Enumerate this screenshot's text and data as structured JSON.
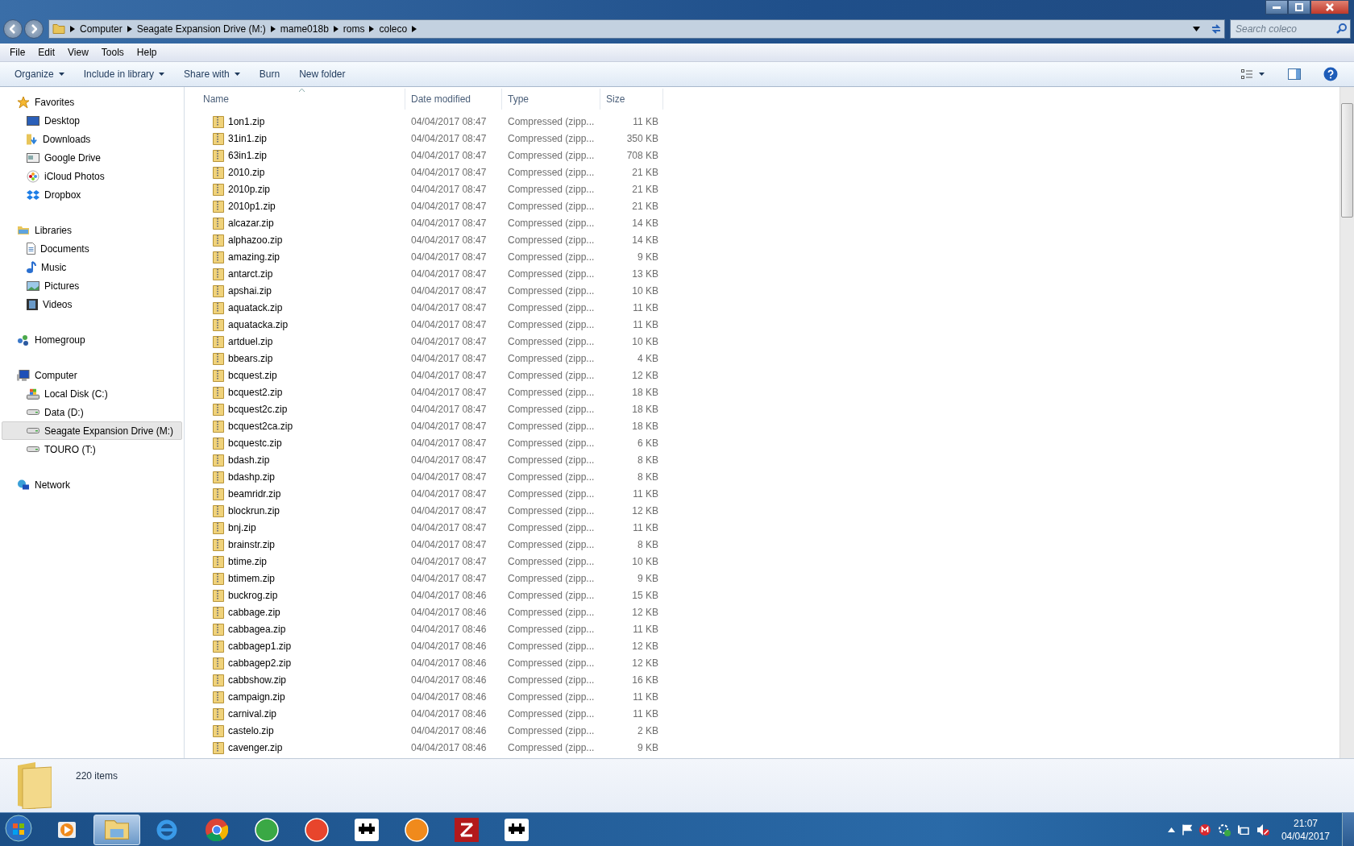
{
  "address": {
    "crumbs": [
      "Computer",
      "Seagate Expansion Drive (M:)",
      "mame018b",
      "roms",
      "coleco"
    ]
  },
  "search": {
    "placeholder": "Search coleco"
  },
  "menu": [
    "File",
    "Edit",
    "View",
    "Tools",
    "Help"
  ],
  "toolbar": [
    {
      "label": "Organize",
      "dropdown": true
    },
    {
      "label": "Include in library",
      "dropdown": true
    },
    {
      "label": "Share with",
      "dropdown": true
    },
    {
      "label": "Burn",
      "dropdown": false
    },
    {
      "label": "New folder",
      "dropdown": false
    }
  ],
  "nav": [
    {
      "label": "Favorites",
      "selected": false,
      "children": [
        {
          "label": "Desktop",
          "selected": false
        },
        {
          "label": "Downloads",
          "selected": false
        },
        {
          "label": "Google Drive",
          "selected": false
        },
        {
          "label": "iCloud Photos",
          "selected": false
        },
        {
          "label": "Dropbox",
          "selected": false
        }
      ]
    },
    {
      "label": "Libraries",
      "selected": false,
      "children": [
        {
          "label": "Documents",
          "selected": false
        },
        {
          "label": "Music",
          "selected": false
        },
        {
          "label": "Pictures",
          "selected": false
        },
        {
          "label": "Videos",
          "selected": false
        }
      ]
    },
    {
      "label": "Homegroup",
      "selected": false
    },
    {
      "label": "Computer",
      "selected": false,
      "children": [
        {
          "label": "Local Disk (C:)",
          "selected": false
        },
        {
          "label": "Data (D:)",
          "selected": false
        },
        {
          "label": "Seagate Expansion Drive (M:)",
          "selected": true
        },
        {
          "label": "TOURO (T:)",
          "selected": false
        }
      ]
    },
    {
      "label": "Network",
      "selected": false
    }
  ],
  "table": {
    "columns": [
      {
        "label": "Name",
        "sorted": true
      },
      {
        "label": "Date modified",
        "sorted": false
      },
      {
        "label": "Type",
        "sorted": false
      },
      {
        "label": "Size",
        "sorted": false
      }
    ],
    "rows": [
      [
        "1on1.zip",
        "04/04/2017 08:47",
        "Compressed (zipp...",
        "11 KB"
      ],
      [
        "31in1.zip",
        "04/04/2017 08:47",
        "Compressed (zipp...",
        "350 KB"
      ],
      [
        "63in1.zip",
        "04/04/2017 08:47",
        "Compressed (zipp...",
        "708 KB"
      ],
      [
        "2010.zip",
        "04/04/2017 08:47",
        "Compressed (zipp...",
        "21 KB"
      ],
      [
        "2010p.zip",
        "04/04/2017 08:47",
        "Compressed (zipp...",
        "21 KB"
      ],
      [
        "2010p1.zip",
        "04/04/2017 08:47",
        "Compressed (zipp...",
        "21 KB"
      ],
      [
        "alcazar.zip",
        "04/04/2017 08:47",
        "Compressed (zipp...",
        "14 KB"
      ],
      [
        "alphazoo.zip",
        "04/04/2017 08:47",
        "Compressed (zipp...",
        "14 KB"
      ],
      [
        "amazing.zip",
        "04/04/2017 08:47",
        "Compressed (zipp...",
        "9 KB"
      ],
      [
        "antarct.zip",
        "04/04/2017 08:47",
        "Compressed (zipp...",
        "13 KB"
      ],
      [
        "apshai.zip",
        "04/04/2017 08:47",
        "Compressed (zipp...",
        "10 KB"
      ],
      [
        "aquatack.zip",
        "04/04/2017 08:47",
        "Compressed (zipp...",
        "11 KB"
      ],
      [
        "aquatacka.zip",
        "04/04/2017 08:47",
        "Compressed (zipp...",
        "11 KB"
      ],
      [
        "artduel.zip",
        "04/04/2017 08:47",
        "Compressed (zipp...",
        "10 KB"
      ],
      [
        "bbears.zip",
        "04/04/2017 08:47",
        "Compressed (zipp...",
        "4 KB"
      ],
      [
        "bcquest.zip",
        "04/04/2017 08:47",
        "Compressed (zipp...",
        "12 KB"
      ],
      [
        "bcquest2.zip",
        "04/04/2017 08:47",
        "Compressed (zipp...",
        "18 KB"
      ],
      [
        "bcquest2c.zip",
        "04/04/2017 08:47",
        "Compressed (zipp...",
        "18 KB"
      ],
      [
        "bcquest2ca.zip",
        "04/04/2017 08:47",
        "Compressed (zipp...",
        "18 KB"
      ],
      [
        "bcquestc.zip",
        "04/04/2017 08:47",
        "Compressed (zipp...",
        "6 KB"
      ],
      [
        "bdash.zip",
        "04/04/2017 08:47",
        "Compressed (zipp...",
        "8 KB"
      ],
      [
        "bdashp.zip",
        "04/04/2017 08:47",
        "Compressed (zipp...",
        "8 KB"
      ],
      [
        "beamridr.zip",
        "04/04/2017 08:47",
        "Compressed (zipp...",
        "11 KB"
      ],
      [
        "blockrun.zip",
        "04/04/2017 08:47",
        "Compressed (zipp...",
        "12 KB"
      ],
      [
        "bnj.zip",
        "04/04/2017 08:47",
        "Compressed (zipp...",
        "11 KB"
      ],
      [
        "brainstr.zip",
        "04/04/2017 08:47",
        "Compressed (zipp...",
        "8 KB"
      ],
      [
        "btime.zip",
        "04/04/2017 08:47",
        "Compressed (zipp...",
        "10 KB"
      ],
      [
        "btimem.zip",
        "04/04/2017 08:47",
        "Compressed (zipp...",
        "9 KB"
      ],
      [
        "buckrog.zip",
        "04/04/2017 08:46",
        "Compressed (zipp...",
        "15 KB"
      ],
      [
        "cabbage.zip",
        "04/04/2017 08:46",
        "Compressed (zipp...",
        "12 KB"
      ],
      [
        "cabbagea.zip",
        "04/04/2017 08:46",
        "Compressed (zipp...",
        "11 KB"
      ],
      [
        "cabbagep1.zip",
        "04/04/2017 08:46",
        "Compressed (zipp...",
        "12 KB"
      ],
      [
        "cabbagep2.zip",
        "04/04/2017 08:46",
        "Compressed (zipp...",
        "12 KB"
      ],
      [
        "cabbshow.zip",
        "04/04/2017 08:46",
        "Compressed (zipp...",
        "16 KB"
      ],
      [
        "campaign.zip",
        "04/04/2017 08:46",
        "Compressed (zipp...",
        "11 KB"
      ],
      [
        "carnival.zip",
        "04/04/2017 08:46",
        "Compressed (zipp...",
        "11 KB"
      ],
      [
        "castelo.zip",
        "04/04/2017 08:46",
        "Compressed (zipp...",
        "2 KB"
      ],
      [
        "cavenger.zip",
        "04/04/2017 08:46",
        "Compressed (zipp...",
        "9 KB"
      ]
    ]
  },
  "status": {
    "count": "220 items"
  },
  "taskbar": {
    "apps": [
      {
        "kind": "media",
        "selected": false
      },
      {
        "kind": "explorer",
        "selected": true
      },
      {
        "kind": "ie",
        "selected": false
      },
      {
        "kind": "chrome",
        "selected": false
      },
      {
        "kind": "green",
        "selected": false
      },
      {
        "kind": "red",
        "selected": false
      },
      {
        "kind": "invader",
        "selected": false
      },
      {
        "kind": "orange",
        "selected": false
      },
      {
        "kind": "filezilla",
        "selected": false
      },
      {
        "kind": "invader",
        "selected": false
      }
    ],
    "time": "21:07",
    "date": "04/04/2017"
  }
}
